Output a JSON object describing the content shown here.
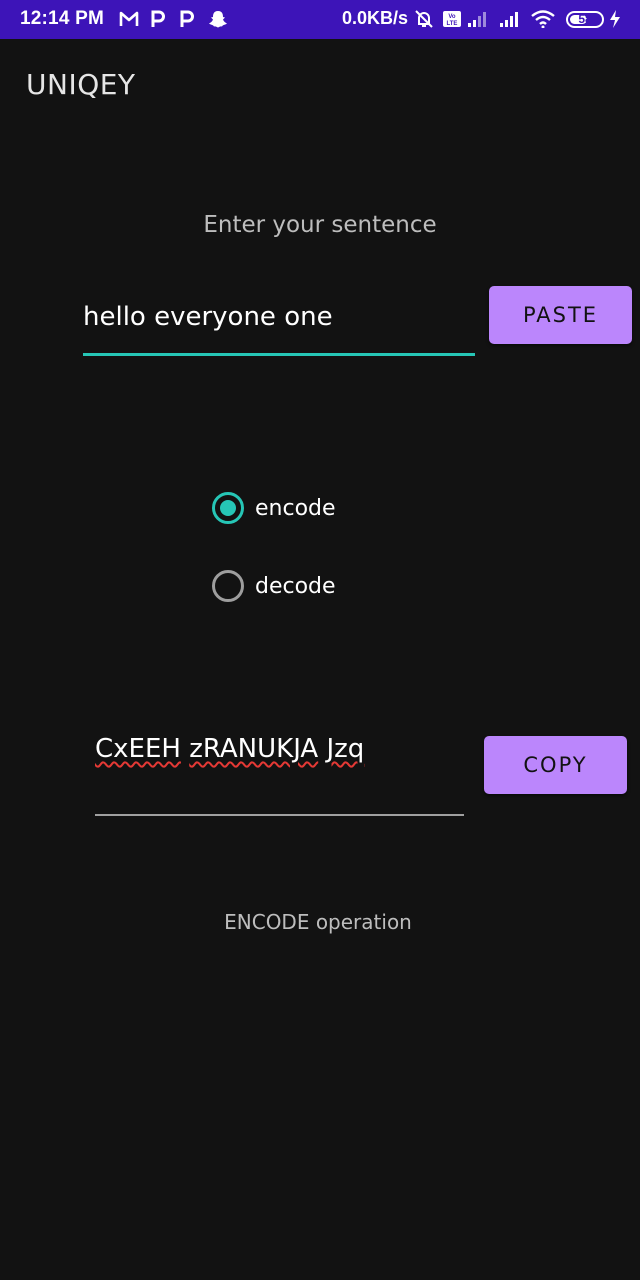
{
  "status_bar": {
    "time": "12:14 PM",
    "notification_icons": [
      "gmail-icon",
      "paytm-icon",
      "paytm-icon",
      "snapchat-icon"
    ],
    "network_speed": "0.0KB/s",
    "system_icons": [
      "alarm-off-icon",
      "volte-icon",
      "signal-icon",
      "signal-icon",
      "wifi-icon"
    ],
    "battery_level": "58",
    "battery_fraction": 0.58,
    "charging_icon": "bolt-icon"
  },
  "app": {
    "title": "UNIQEY"
  },
  "input_section": {
    "prompt": "Enter your sentence",
    "value": "hello everyone one",
    "paste_label": "PASTE"
  },
  "mode": {
    "options": [
      {
        "label": "encode",
        "selected": true
      },
      {
        "label": "decode",
        "selected": false
      }
    ]
  },
  "result": {
    "words": [
      "CxEEH",
      "zRANUKJA",
      "Jzq"
    ],
    "copy_label": "COPY"
  },
  "operation_label": "ENCODE operation",
  "colors": {
    "status_bar": "#3d14b8",
    "background": "#121212",
    "accent": "#26c6b6",
    "button": "#bb86fc"
  }
}
